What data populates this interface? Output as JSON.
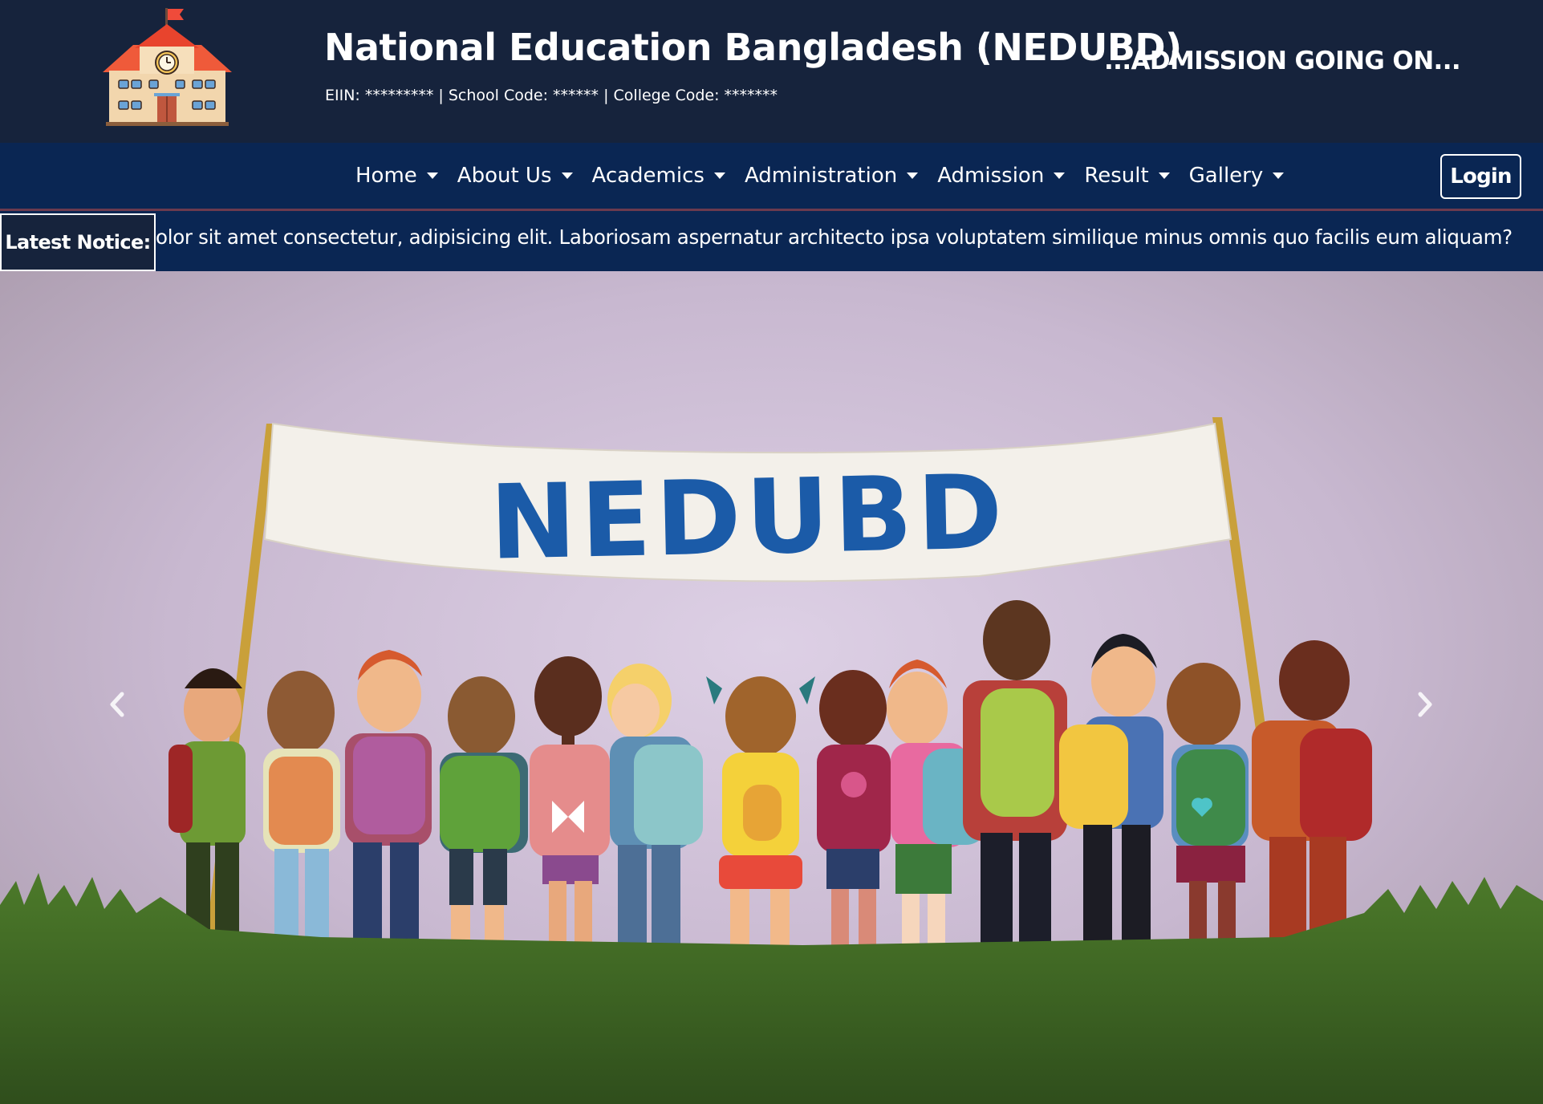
{
  "header": {
    "title": "National Education Bangladesh (NEDUBD)",
    "codes": "EIIN: ********* | School Code: ****** | College Code: *******",
    "admission_text": "...ADMISSION GOING ON..."
  },
  "nav": {
    "items": [
      {
        "label": "Home"
      },
      {
        "label": "About Us"
      },
      {
        "label": "Academics"
      },
      {
        "label": "Administration"
      },
      {
        "label": "Admission"
      },
      {
        "label": "Result"
      },
      {
        "label": "Gallery"
      }
    ],
    "login_label": "Login"
  },
  "notice": {
    "label": "Latest Notice:",
    "text": "olor sit amet consectetur, adipisicing elit. Laboriosam aspernatur architecto ipsa voluptatem similique minus omnis quo facilis eum aliquam?"
  },
  "hero": {
    "banner_text": "NEDUBD",
    "prev_icon": "chevron-left-icon",
    "next_icon": "chevron-right-icon"
  },
  "colors": {
    "header_bg": "#16233c",
    "nav_bg": "#0a2653",
    "banner_text": "#1b5ba8",
    "grass": "#3e6b22"
  }
}
